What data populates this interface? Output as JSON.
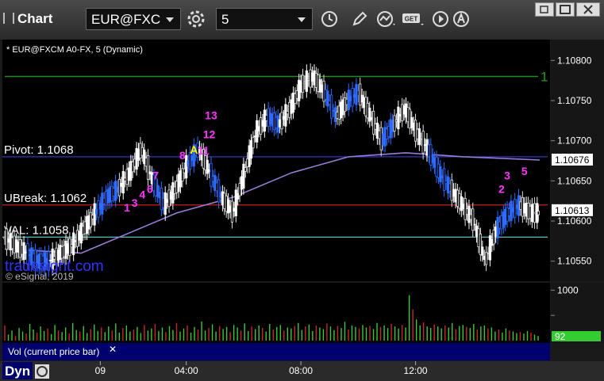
{
  "app": {
    "title": "Chart"
  },
  "toolbar": {
    "symbol": "EUR@FXC",
    "interval": "5"
  },
  "chart_data": {
    "type": "candlestick",
    "title": "* EUR@FXCM A0-FX, 5 (Dynamic)",
    "watermark": "tradesight.com",
    "copyright": "© eSignal, 2019",
    "price_axis": {
      "min": 1.1053,
      "max": 1.1082,
      "ticks": [
        "1.10800",
        "1.10750",
        "1.10700",
        "1.10650",
        "1.10600",
        "1.10550"
      ]
    },
    "time_axis": {
      "labels": [
        "09",
        "04:00",
        "08:00",
        "12:00"
      ]
    },
    "levels": [
      {
        "label": "Pivot: 1.1068",
        "value": 1.1068,
        "color": "#3a3ad8"
      },
      {
        "label": "UBreak: 1.1062",
        "value": 1.1062,
        "color": "#c81e1e"
      },
      {
        "label": "VAL: 1.1058",
        "value": 1.1058,
        "color": "#6fd3d0"
      }
    ],
    "price_tags": [
      {
        "text": "1.10676",
        "value": 1.10676,
        "bg": "#ffffff",
        "fg": "#000000"
      },
      {
        "text": "1.10613",
        "value": 1.10613,
        "bg": "#ffffff",
        "fg": "#000000"
      }
    ],
    "target_lines": [
      {
        "label": "1",
        "value": 1.1078
      }
    ],
    "series": [
      {
        "name": "EUR@FXCM",
        "points": [
          [
            0,
            1.1058
          ],
          [
            6,
            1.1057
          ],
          [
            12,
            1.1056
          ],
          [
            18,
            1.1055
          ],
          [
            24,
            1.1055
          ],
          [
            30,
            1.1056
          ],
          [
            36,
            1.1057
          ],
          [
            42,
            1.1059
          ],
          [
            48,
            1.1061
          ],
          [
            54,
            1.1063
          ],
          [
            60,
            1.1064
          ],
          [
            66,
            1.1066
          ],
          [
            72,
            1.1069
          ],
          [
            78,
            1.1065
          ],
          [
            84,
            1.1062
          ],
          [
            90,
            1.1064
          ],
          [
            96,
            1.1067
          ],
          [
            102,
            1.1069
          ],
          [
            108,
            1.1066
          ],
          [
            114,
            1.1063
          ],
          [
            120,
            1.1061
          ],
          [
            126,
            1.1066
          ],
          [
            132,
            1.1071
          ],
          [
            138,
            1.1073
          ],
          [
            144,
            1.1072
          ],
          [
            150,
            1.1074
          ],
          [
            156,
            1.1077
          ],
          [
            162,
            1.1078
          ],
          [
            168,
            1.1076
          ],
          [
            174,
            1.1073
          ],
          [
            180,
            1.1075
          ],
          [
            186,
            1.1076
          ],
          [
            192,
            1.1073
          ],
          [
            198,
            1.107
          ],
          [
            204,
            1.1072
          ],
          [
            210,
            1.1074
          ],
          [
            216,
            1.1071
          ],
          [
            222,
            1.1069
          ],
          [
            228,
            1.1066
          ],
          [
            234,
            1.1064
          ],
          [
            240,
            1.1062
          ],
          [
            246,
            1.106
          ],
          [
            252,
            1.1055
          ],
          [
            258,
            1.1059
          ],
          [
            264,
            1.1061
          ],
          [
            270,
            1.1062
          ],
          [
            276,
            1.1061
          ],
          [
            280,
            1.1061
          ]
        ]
      },
      {
        "name": "Average",
        "points": [
          [
            0,
            1.10565
          ],
          [
            40,
            1.1056
          ],
          [
            60,
            1.1058
          ],
          [
            90,
            1.1061
          ],
          [
            120,
            1.1063
          ],
          [
            150,
            1.1066
          ],
          [
            180,
            1.1068
          ],
          [
            210,
            1.10685
          ],
          [
            240,
            1.1068
          ],
          [
            280,
            1.10676
          ]
        ]
      }
    ],
    "labels": [
      {
        "text": "1",
        "x": 64,
        "v": 1.10612,
        "color": "#ff33ff"
      },
      {
        "text": "3",
        "x": 68,
        "v": 1.10618,
        "color": "#ff33ff"
      },
      {
        "text": "4",
        "x": 72,
        "v": 1.10628,
        "color": "#ff33ff"
      },
      {
        "text": "6",
        "x": 76,
        "v": 1.10635,
        "color": "#ff33ff"
      },
      {
        "text": "7",
        "x": 79,
        "v": 1.10652,
        "color": "#ff33ff"
      },
      {
        "text": "8",
        "x": 93,
        "v": 1.10677,
        "color": "#ff33ff"
      },
      {
        "text": "A",
        "x": 99,
        "v": 1.10684,
        "color": "#ffff00"
      },
      {
        "text": "11",
        "x": 104,
        "v": 1.10683,
        "color": "#ff33ff"
      },
      {
        "text": "12",
        "x": 107,
        "v": 1.10703,
        "color": "#ff33ff"
      },
      {
        "text": "13",
        "x": 108,
        "v": 1.10727,
        "color": "#ff33ff"
      },
      {
        "text": "2",
        "x": 260,
        "v": 1.10635,
        "color": "#ff33ff"
      },
      {
        "text": "3",
        "x": 263,
        "v": 1.10652,
        "color": "#ff33ff"
      },
      {
        "text": "5",
        "x": 272,
        "v": 1.10657,
        "color": "#ff33ff"
      }
    ],
    "volume": {
      "label": "Vol (current price bar)",
      "ticks": [
        "1000",
        "500"
      ],
      "current": "92",
      "max": 1100,
      "values": [
        300,
        120,
        200,
        90,
        250,
        180,
        140,
        330,
        220,
        160,
        280,
        190,
        240,
        130,
        310,
        200,
        170,
        260,
        140,
        350,
        210,
        180,
        290,
        150,
        230,
        320,
        190,
        260,
        170,
        280,
        200,
        340,
        160,
        250,
        300,
        180,
        220,
        270,
        150,
        310,
        200,
        240,
        330,
        190,
        260,
        170,
        290,
        210,
        350,
        180,
        240,
        300,
        160,
        270,
        220,
        380,
        200,
        250,
        320,
        180,
        290,
        230,
        270,
        170,
        310,
        260,
        200,
        340,
        190,
        280,
        230,
        300,
        250,
        180,
        330,
        220,
        270,
        310,
        200,
        260,
        240,
        290,
        350,
        210,
        280,
        320,
        190,
        300,
        260,
        230,
        340,
        280,
        210,
        290,
        250,
        370,
        220,
        300,
        270,
        240,
        310,
        260,
        290,
        230,
        350,
        270,
        300,
        250,
        330,
        280,
        240,
        310,
        260,
        900,
        620,
        420,
        300,
        360,
        280,
        250,
        320,
        280,
        240,
        300,
        260,
        350,
        230,
        290,
        310,
        270,
        250,
        330,
        220,
        280,
        300,
        240,
        260,
        180,
        220,
        160,
        240,
        200,
        180,
        150,
        170,
        140,
        190,
        160,
        120,
        92
      ]
    }
  },
  "bottom": {
    "tab": "Dyn"
  }
}
